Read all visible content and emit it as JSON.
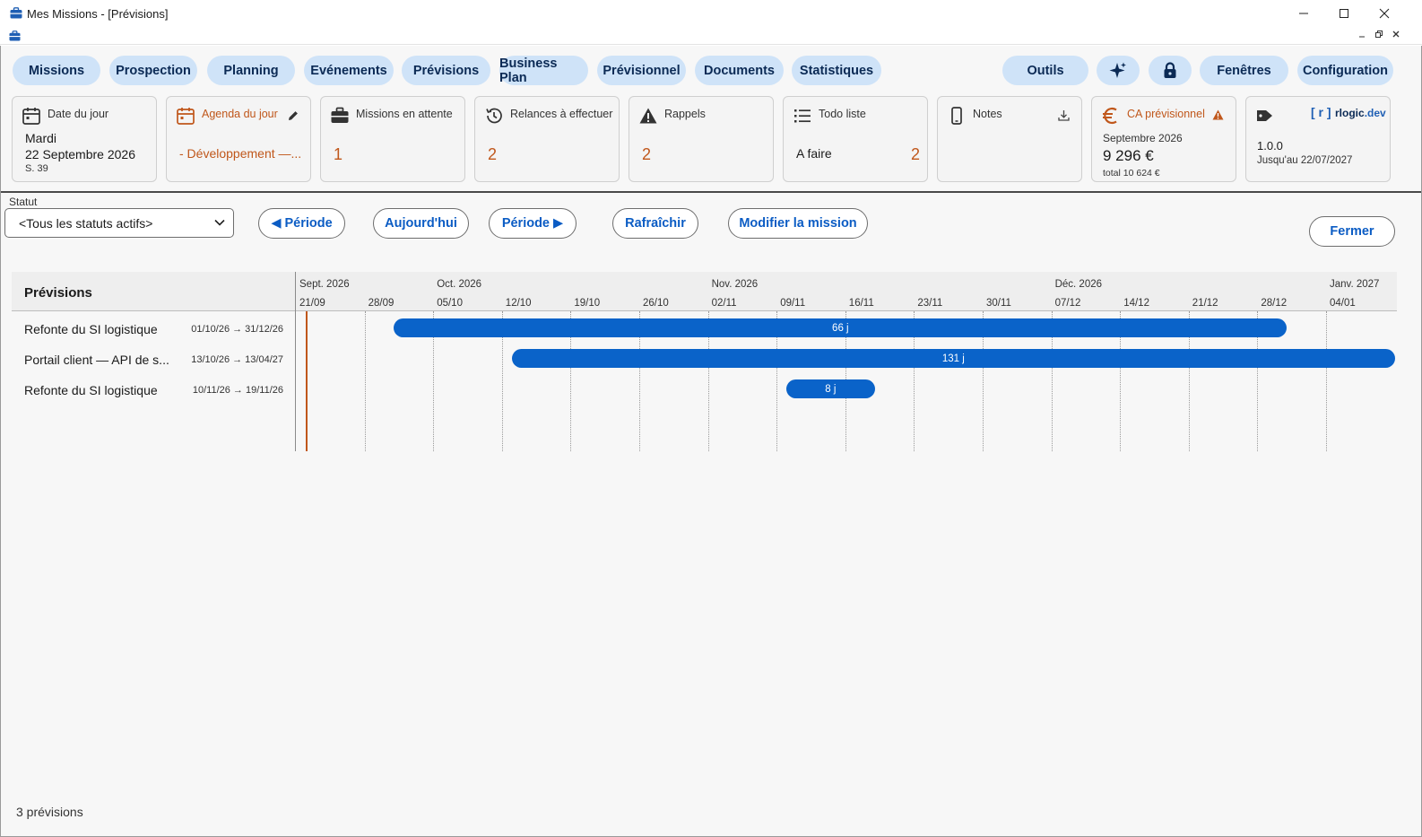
{
  "window": {
    "title": "Mes Missions - [Prévisions]"
  },
  "nav": {
    "items": [
      "Missions",
      "Prospection",
      "Planning",
      "Evénements",
      "Prévisions",
      "Business Plan",
      "Prévisionnel",
      "Documents",
      "Statistiques"
    ],
    "right": [
      "Outils",
      "Fenêtres",
      "Configuration"
    ]
  },
  "widgets": {
    "date": {
      "title": "Date du jour",
      "day": "Mardi",
      "date": "22 Septembre 2026",
      "week": "S. 39"
    },
    "agenda": {
      "title": "Agenda du jour",
      "item": "- Développement —..."
    },
    "missions": {
      "title": "Missions en attente",
      "count": "1"
    },
    "relances": {
      "title": "Relances à effectuer",
      "count": "2"
    },
    "rappels": {
      "title": "Rappels",
      "count": "2"
    },
    "todo": {
      "title": "Todo liste",
      "label": "A faire",
      "count": "2"
    },
    "notes": {
      "title": "Notes"
    },
    "ca": {
      "title": "CA prévisionnel",
      "month": "Septembre 2026",
      "amount": "9 296 €",
      "total": "total 10 624 €"
    },
    "license": {
      "brand_bracket": "[ r ]",
      "brand_name": "rlogic",
      "brand_tld": ".dev",
      "version": "1.0.0",
      "until": "Jusqu'au 22/07/2027"
    }
  },
  "toolbar": {
    "statut_label": "Statut",
    "statut_value": "<Tous les statuts actifs>",
    "prev_period": "◀ Période",
    "today": "Aujourd'hui",
    "next_period": "Période ▶",
    "refresh": "Rafraîchir",
    "edit_mission": "Modifier la mission",
    "close": "Fermer"
  },
  "gantt": {
    "title": "Prévisions",
    "months": [
      "Sept. 2026",
      "Oct. 2026",
      "Nov. 2026",
      "Déc. 2026",
      "Janv. 2027"
    ],
    "weeks": [
      "21/09",
      "28/09",
      "05/10",
      "12/10",
      "19/10",
      "26/10",
      "02/11",
      "09/11",
      "16/11",
      "23/11",
      "30/11",
      "07/12",
      "14/12",
      "21/12",
      "28/12",
      "04/01"
    ],
    "rows": [
      {
        "name": "Refonte du SI logistique",
        "dates": "01/10/26 → 31/12/26",
        "label": "66 j",
        "start": "2026-10-01",
        "end": "2026-12-31"
      },
      {
        "name": "Portail client — API de s...",
        "dates": "13/10/26 → 13/04/27",
        "label": "131 j",
        "start": "2026-10-13",
        "end": "2027-04-13"
      },
      {
        "name": "Refonte du SI logistique",
        "dates": "10/11/26 → 19/11/26",
        "label": "8 j",
        "start": "2026-11-10",
        "end": "2026-11-19"
      }
    ]
  },
  "footer": {
    "count": "3 prévisions"
  },
  "colors": {
    "accent": "#0a63c9",
    "pill": "#cfe3f8",
    "orange": "#c0571b"
  }
}
